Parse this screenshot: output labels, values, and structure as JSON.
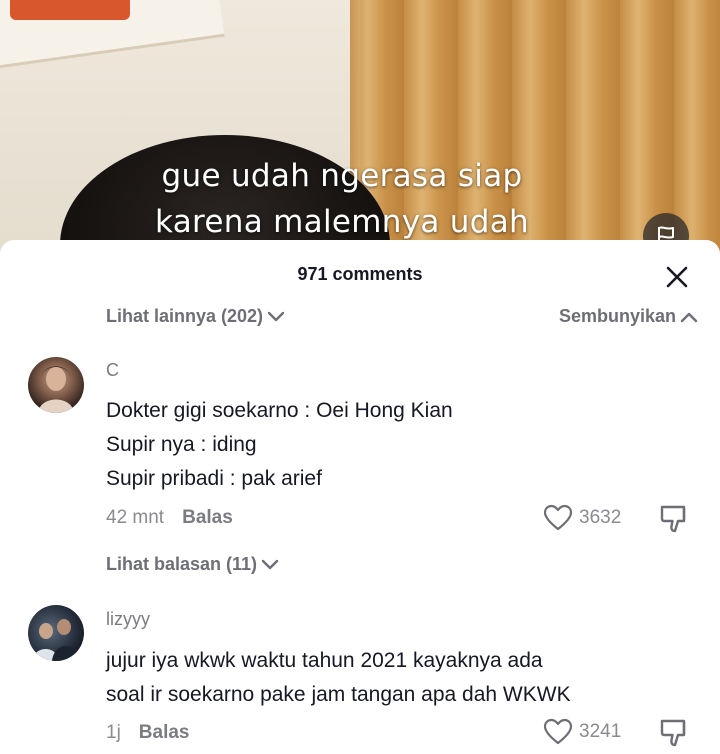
{
  "video": {
    "caption_line1": "gue udah ngerasa siap",
    "caption_line2": "karena malemnya udah",
    "flag_icon": "flag-icon"
  },
  "comments_sheet": {
    "title": "971 comments",
    "close_icon": "close-icon",
    "see_more_label": "Lihat lainnya (202)",
    "hide_label": "Sembunyikan"
  },
  "comments": [
    {
      "username": "C",
      "lines": [
        "Dokter gigi soekarno : Oei Hong Kian",
        "Supir nya : iding",
        "Supir pribadi : pak arief"
      ],
      "time": "42 mnt",
      "reply_label": "Balas",
      "likes": "3632",
      "view_replies_label": "Lihat balasan (11)"
    },
    {
      "username": "lizyyy",
      "lines": [
        "jujur iya wkwk waktu tahun 2021 kayaknya ada",
        "soal ir soekarno pake jam tangan apa dah WKWK"
      ],
      "time": "1j",
      "reply_label": "Balas",
      "likes": "3241"
    }
  ],
  "colors": {
    "text_primary": "#161823",
    "text_secondary": "#7b7c82",
    "sheet_background": "#ffffff"
  }
}
